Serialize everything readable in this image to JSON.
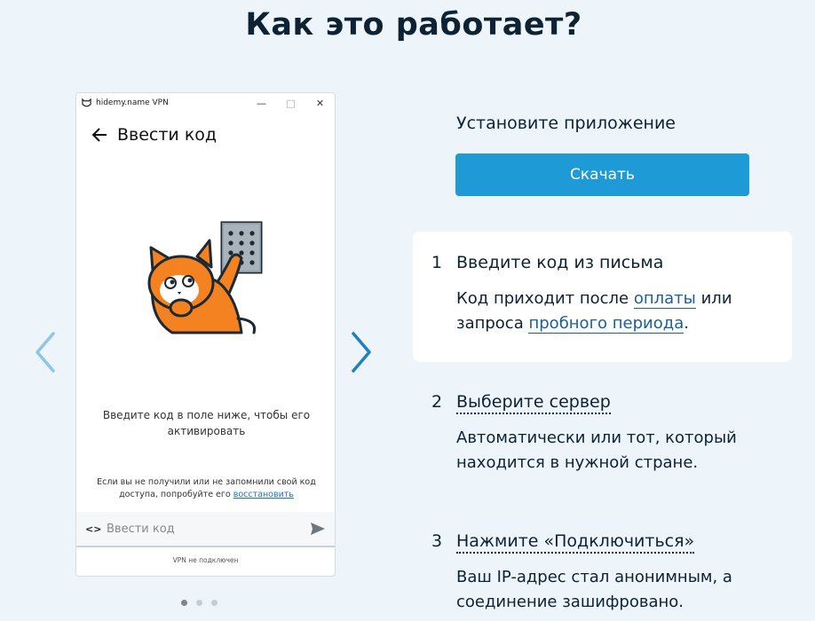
{
  "page": {
    "title": "Как это работает?"
  },
  "app_window": {
    "window_title": "hidemy.name VPN",
    "header_title": "Ввести код",
    "instruction": "Введите код в поле ниже, чтобы его активировать",
    "hint_text": "Если вы не получили или не запомнили свой код доступа, попробуйте его",
    "hint_link": "восстановить",
    "code_icon": "<>",
    "code_placeholder": "Ввести код",
    "vpn_status": "VPN не подключен"
  },
  "install": {
    "label": "Установите приложение",
    "download_button": "Скачать"
  },
  "steps": [
    {
      "number": "1",
      "title": "Введите код из письма",
      "desc_part1": "Код приходит после",
      "link1": "оплаты",
      "desc_part2": "или запроса",
      "link2": "пробного периода",
      "desc_part3": "."
    },
    {
      "number": "2",
      "title": "Выберите сервер",
      "desc": "Автоматически или тот, который находится в нужной стране."
    },
    {
      "number": "3",
      "title": "Нажмите «Подключиться»",
      "desc": "Ваш IP-адрес стал анонимным, а соединение зашифровано."
    }
  ],
  "carousel": {
    "active_index": 0,
    "total": 3
  },
  "colors": {
    "background": "#eef5fa",
    "accent": "#1e9ad6",
    "text": "#0d2233",
    "cat_orange": "#f58220"
  }
}
